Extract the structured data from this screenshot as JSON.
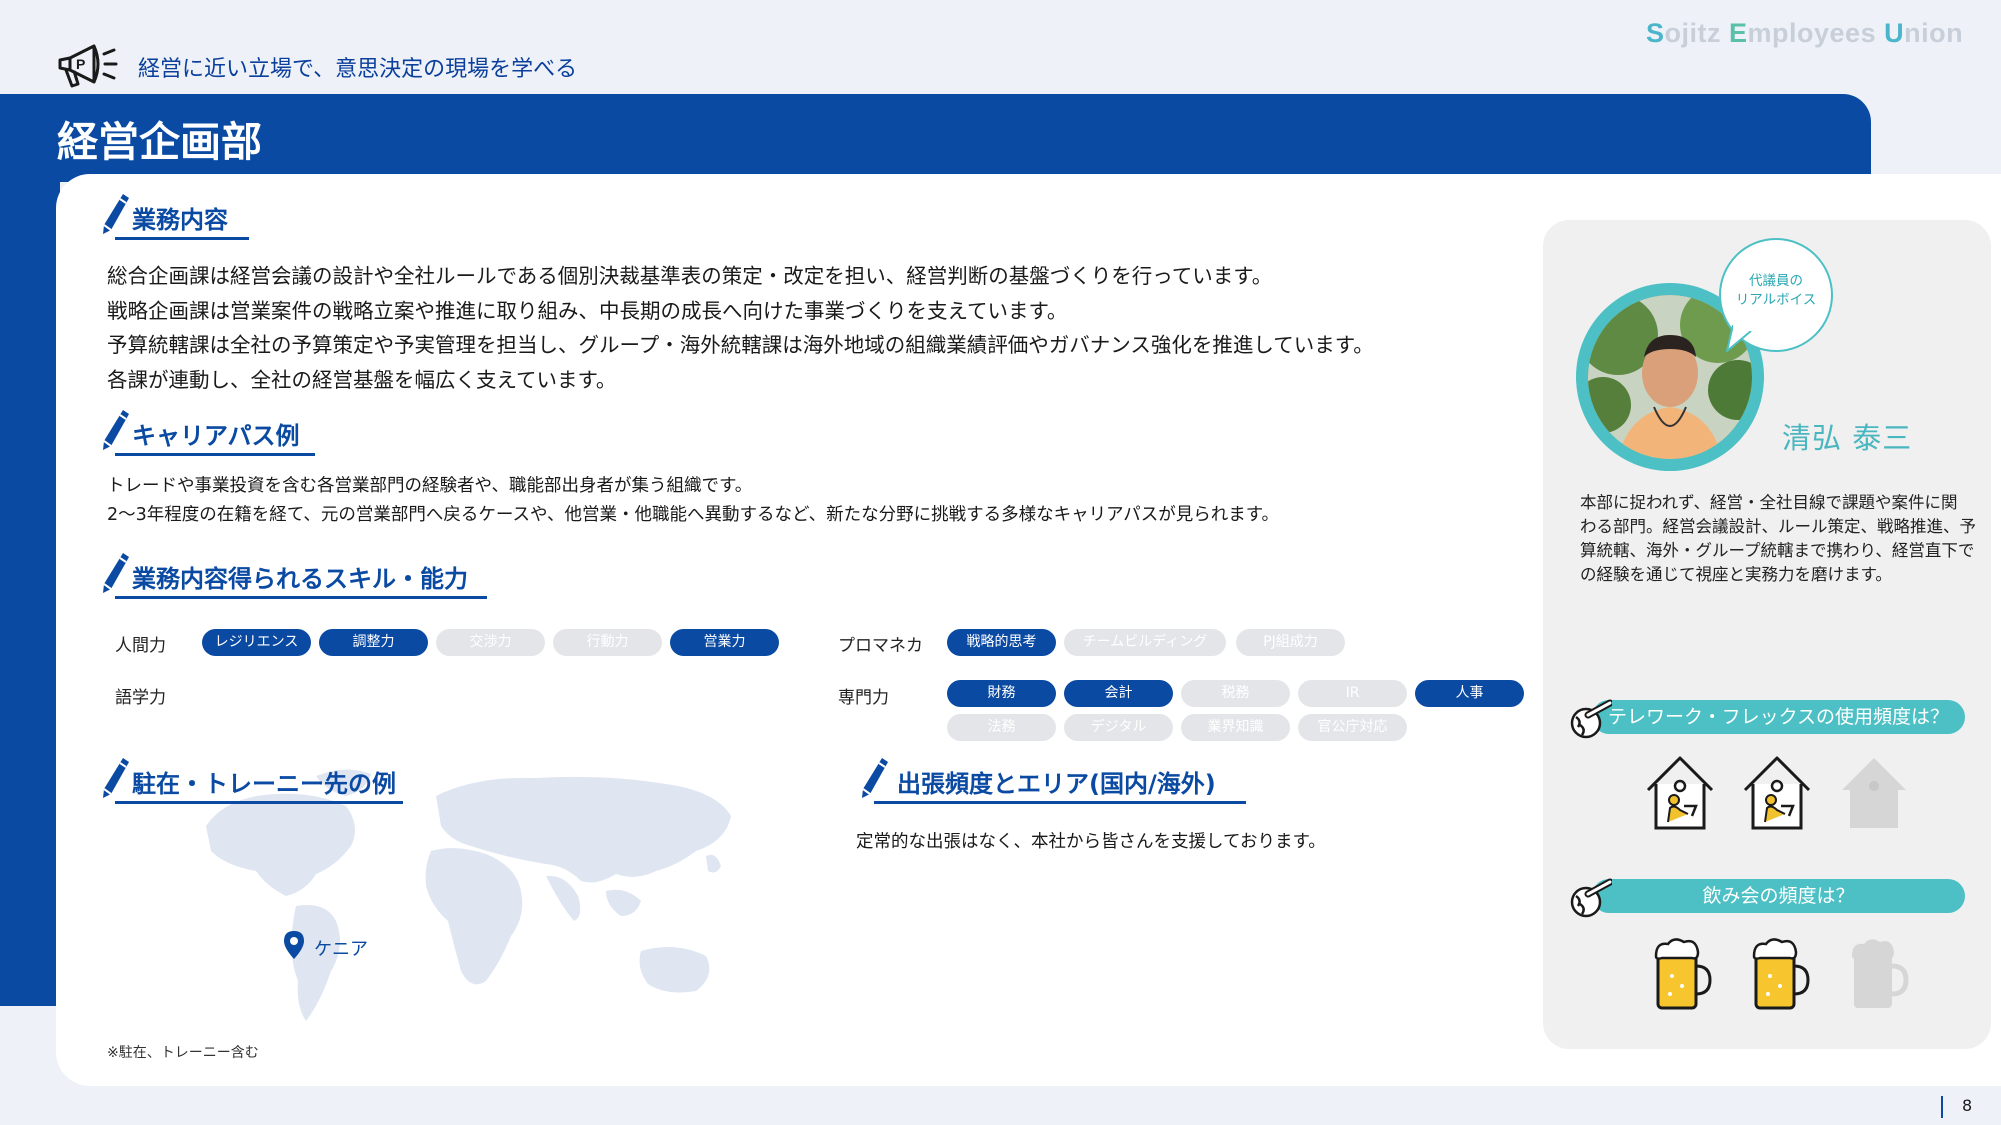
{
  "header": {
    "brand": {
      "s": "S",
      "ojitz": "ojitz ",
      "e": "E",
      "mployees": "mployees ",
      "u": "U",
      "nion": "nion"
    },
    "tagline": "経営に近い立場で、意思決定の現場を学べる",
    "page_title": "経営企画部"
  },
  "sections": {
    "business": {
      "title": "業務内容",
      "lines": [
        "総合企画課は経営会議の設計や全社ルールである個別決裁基準表の策定・改定を担い、経営判断の基盤づくりを行っています。",
        "戦略企画課は営業案件の戦略立案や推進に取り組み、中長期の成長へ向けた事業づくりを支えています。",
        "予算統轄課は全社の予算策定や予実管理を担当し、グループ・海外統轄課は海外地域の組織業績評価やガバナンス強化を推進しています。",
        "各課が連動し、全社の経営基盤を幅広く支えています。"
      ]
    },
    "career": {
      "title": "キャリアパス例",
      "lines": [
        "トレードや事業投資を含む各営業部門の経験者や、職能部出身者が集う組織です。",
        "2～3年程度の在籍を経て、元の営業部門へ戻るケースや、他営業・他職能へ異動するなど、新たな分野に挑戦する多様なキャリアパスが見られます。"
      ]
    },
    "skills": {
      "title": "業務内容得られるスキル・能力",
      "groups": [
        {
          "label": "人間力",
          "items": [
            {
              "text": "レジリエンス",
              "active": true
            },
            {
              "text": "調整力",
              "active": true
            },
            {
              "text": "交渉力",
              "active": false
            },
            {
              "text": "行動力",
              "active": false
            },
            {
              "text": "営業力",
              "active": true
            }
          ]
        },
        {
          "label": "プロマネカ",
          "items": [
            {
              "text": "戦略的思考",
              "active": true
            },
            {
              "text": "チームビルディング",
              "active": false
            },
            {
              "text": "PJ組成力",
              "active": false
            }
          ]
        },
        {
          "label": "語学力",
          "items": []
        },
        {
          "label": "専門力",
          "items": [
            {
              "text": "財務",
              "active": true
            },
            {
              "text": "会計",
              "active": true
            },
            {
              "text": "税務",
              "active": false
            },
            {
              "text": "IR",
              "active": false
            },
            {
              "text": "人事",
              "active": true
            },
            {
              "text": "法務",
              "active": false
            },
            {
              "text": "デジタル",
              "active": false
            },
            {
              "text": "業界知識",
              "active": false
            },
            {
              "text": "官公庁対応",
              "active": false
            }
          ]
        }
      ]
    },
    "overseas": {
      "title": "駐在・トレーニー先の例",
      "pin_label": "ケニア",
      "note": "※駐在、トレーニー含む"
    },
    "travel": {
      "title": "出張頻度とエリア(国内/海外)",
      "text": "定常的な出張はなく、本社から皆さんを支援しております。"
    }
  },
  "voice": {
    "bubble_line1": "代議員の",
    "bubble_line2": "リアルボイス",
    "name": "清弘 泰三",
    "description": [
      "本部に捉われず、経営・全社目線で課題や案件に関",
      "わる部門。経営会議設計、ルール策定、戦略推進、予",
      "算統轄、海外・グループ統轄まで携わり、経営直下で",
      "の経験を通じて視座と実務力を磨けます。"
    ],
    "telework": {
      "question": "テレワーク・フレックスの使用頻度は？",
      "level": 2,
      "max": 3
    },
    "drinking": {
      "question": "飲み会の頻度は？",
      "level": 2,
      "max": 3
    }
  },
  "footer": {
    "page": "8"
  },
  "colors": {
    "primary": "#0a4aa3",
    "teal": "#4cc0c4",
    "inactive": "#e3e5e9"
  }
}
